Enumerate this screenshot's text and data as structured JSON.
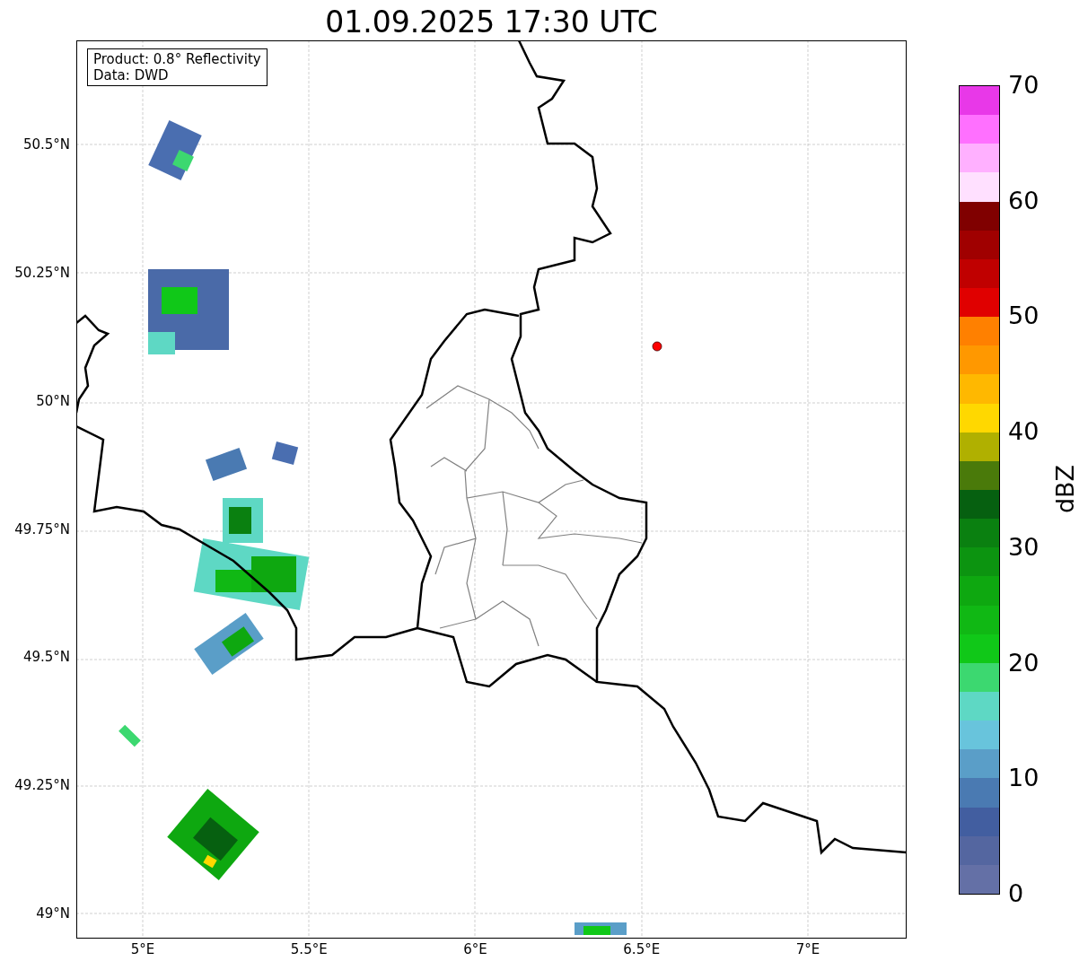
{
  "title": "01.09.2025 17:30 UTC",
  "info_box": [
    "Product: 0.8° Reflectivity",
    "Data: DWD"
  ],
  "map": {
    "x_ticks": [
      "5°E",
      "5.5°E",
      "6°E",
      "6.5°E",
      "7°E"
    ],
    "y_ticks": [
      "50.5°N",
      "50.25°N",
      "50°N",
      "49.75°N",
      "49.5°N",
      "49.25°N",
      "49°N"
    ]
  },
  "colorbar": {
    "label": "dBZ",
    "ticks": [
      "70",
      "60",
      "50",
      "40",
      "30",
      "20",
      "10",
      "0"
    ],
    "segments": [
      {
        "color": "#e838e8"
      },
      {
        "color": "#ff70ff"
      },
      {
        "color": "#ffb0ff"
      },
      {
        "color": "#ffe0ff"
      },
      {
        "color": "#800000"
      },
      {
        "color": "#a00000"
      },
      {
        "color": "#c00000"
      },
      {
        "color": "#e00000"
      },
      {
        "color": "#ff8000"
      },
      {
        "color": "#ff9800"
      },
      {
        "color": "#ffb800"
      },
      {
        "color": "#ffd800"
      },
      {
        "color": "#b0b000"
      },
      {
        "color": "#4a7a0a"
      },
      {
        "color": "#066010"
      },
      {
        "color": "#0a8010"
      },
      {
        "color": "#0c9410"
      },
      {
        "color": "#0ea810"
      },
      {
        "color": "#10b814"
      },
      {
        "color": "#10c818"
      },
      {
        "color": "#3cd870"
      },
      {
        "color": "#5ed8c4"
      },
      {
        "color": "#68c4dc"
      },
      {
        "color": "#5a9ec8"
      },
      {
        "color": "#4a7ab2"
      },
      {
        "color": "#425ea0"
      },
      {
        "color": "#5466a0"
      },
      {
        "color": "#6470a6"
      }
    ]
  }
}
